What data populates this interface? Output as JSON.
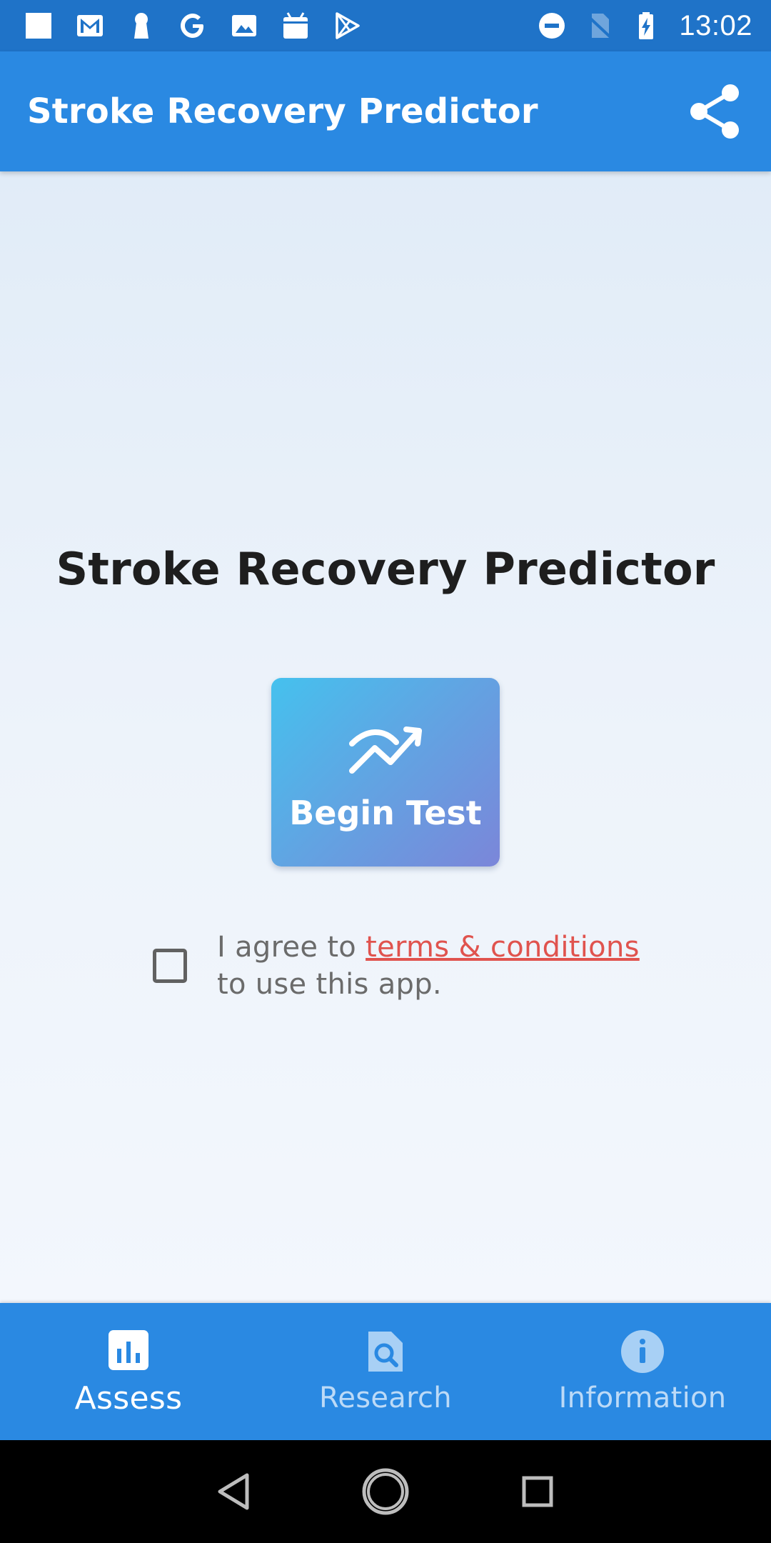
{
  "status_bar": {
    "time": "13:02",
    "left_icons": [
      "square-notification-icon",
      "gmail-icon",
      "keyhole-icon",
      "google-icon",
      "photo-icon",
      "android-icon",
      "play-store-icon"
    ],
    "right_icons": [
      "do-not-disturb-icon",
      "no-sim-icon",
      "battery-charging-icon"
    ]
  },
  "app_bar": {
    "title": "Stroke Recovery Predictor",
    "share_icon": "share-icon",
    "color": "#2a89e2"
  },
  "main": {
    "heading": "Stroke Recovery Predictor",
    "begin_test": {
      "label": "Begin Test",
      "icon": "trend-chart-icon"
    },
    "agreement": {
      "prefix": "I agree to ",
      "link": "terms & conditions",
      "suffix": "to use this app.",
      "checked": false,
      "link_color": "#e0534e"
    }
  },
  "bottom_nav": {
    "items": [
      {
        "label": "Assess",
        "icon": "bar-chart-icon",
        "active": true
      },
      {
        "label": "Research",
        "icon": "document-search-icon",
        "active": false
      },
      {
        "label": "Information",
        "icon": "info-icon",
        "active": false
      }
    ]
  },
  "system_nav": {
    "buttons": [
      "back-icon",
      "home-icon",
      "recents-icon"
    ]
  }
}
